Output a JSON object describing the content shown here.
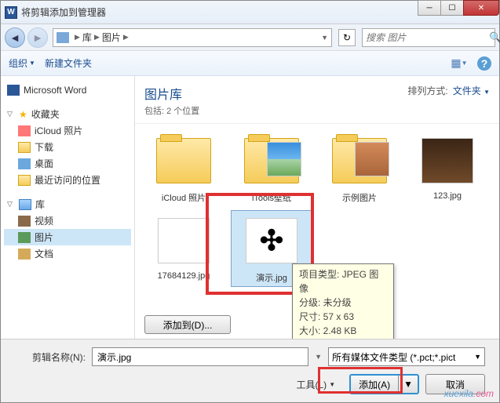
{
  "window": {
    "title": "将剪辑添加到管理器",
    "icon_letter": "W"
  },
  "breadcrumb": {
    "items": [
      "库",
      "图片"
    ]
  },
  "search": {
    "placeholder": "搜索 图片"
  },
  "toolbar": {
    "organize": "组织",
    "new_folder": "新建文件夹"
  },
  "sidebar": {
    "word": "Microsoft Word",
    "favorites": "收藏夹",
    "fav_items": [
      "iCloud 照片",
      "下载",
      "桌面",
      "最近访问的位置"
    ],
    "libraries": "库",
    "lib_items": [
      "视频",
      "图片",
      "文档"
    ]
  },
  "library_header": {
    "title": "图片库",
    "subtitle": "包括: 2 个位置",
    "sort_label": "排列方式:",
    "sort_value": "文件夹"
  },
  "files": [
    {
      "name": "iCloud 照片",
      "type": "folder"
    },
    {
      "name": "iTools壁纸",
      "type": "folder-img"
    },
    {
      "name": "示例图片",
      "type": "folder-sample"
    },
    {
      "name": "123.jpg",
      "type": "image"
    },
    {
      "name": "17684129.jpg",
      "type": "image-white"
    },
    {
      "name": "演示.jpg",
      "type": "image-cross",
      "selected": true
    }
  ],
  "add_to_label": "添加到(D)...",
  "tooltip": {
    "l1": "项目类型: JPEG 图像",
    "l2": "分级: 未分级",
    "l3": "尺寸: 57 x 63",
    "l4": "大小: 2.48 KB"
  },
  "bottom": {
    "filename_label": "剪辑名称(N):",
    "filename_value": "演示.jpg",
    "filetype_value": "所有媒体文件类型 (*.pct;*.pict",
    "tools_label": "工具(L)",
    "add_label": "添加(A)",
    "cancel_label": "取消"
  },
  "watermark": {
    "part1": "xuexila",
    "part2": ".com"
  }
}
